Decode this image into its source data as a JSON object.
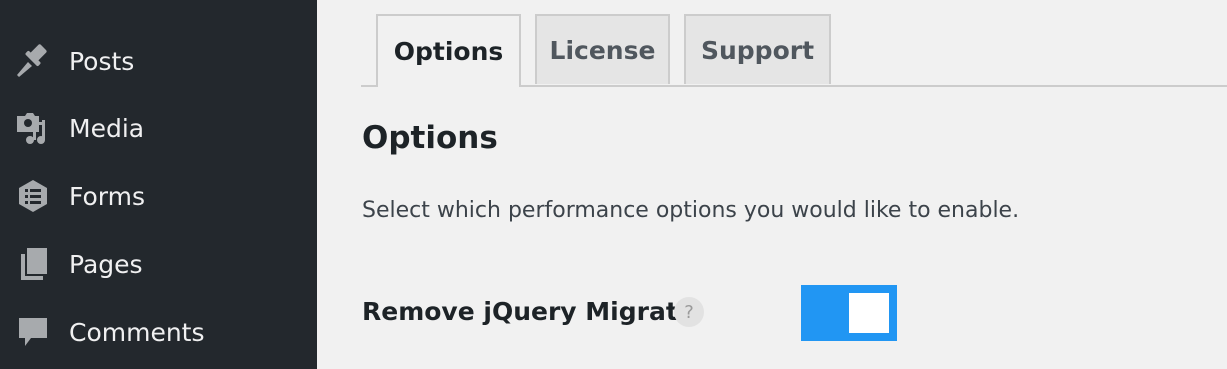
{
  "sidebar": {
    "items": [
      {
        "label": "Posts",
        "icon": "pushpin-icon"
      },
      {
        "label": "Media",
        "icon": "media-icon"
      },
      {
        "label": "Forms",
        "icon": "forms-icon"
      },
      {
        "label": "Pages",
        "icon": "pages-icon"
      },
      {
        "label": "Comments",
        "icon": "comment-icon"
      }
    ]
  },
  "tabs": [
    {
      "label": "Options",
      "active": true
    },
    {
      "label": "License",
      "active": false
    },
    {
      "label": "Support",
      "active": false
    }
  ],
  "main": {
    "title": "Options",
    "description": "Select which performance options you would like to enable.",
    "options": [
      {
        "label": "Remove jQuery Migrate",
        "help": "?",
        "enabled": true
      }
    ]
  },
  "colors": {
    "sidebar_bg": "#23282d",
    "page_bg": "#f1f1f1",
    "toggle_on": "#2196f3"
  }
}
